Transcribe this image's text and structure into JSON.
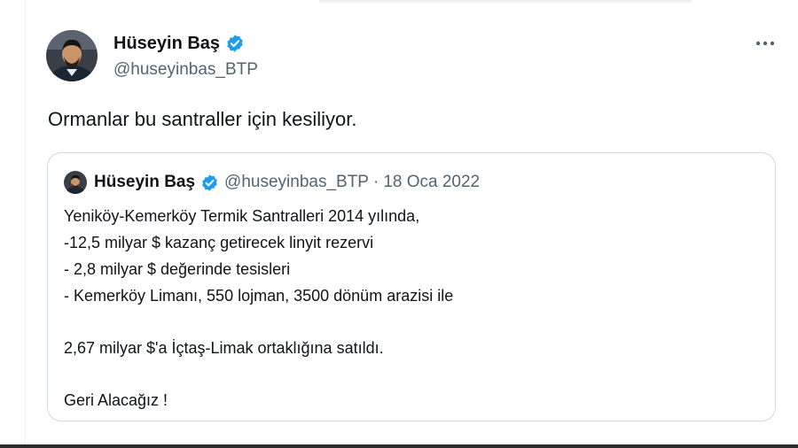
{
  "tweet": {
    "author_name": "Hüseyin Baş",
    "author_handle": "@huseyinbas_BTP",
    "text": "Ormanlar bu santraller için kesiliyor.",
    "more_icon": "more-horizontal-icon"
  },
  "quoted_tweet": {
    "author_name": "Hüseyin Baş",
    "author_handle": "@huseyinbas_BTP",
    "separator": "·",
    "date": "18 Oca 2022",
    "lines": {
      "l1": "Yeniköy-Kemerköy Termik Santralleri 2014 yılında,",
      "l2": "-12,5 milyar $ kazanç getirecek linyit rezervi",
      "l3": "- 2,8 milyar $ değerinde tesisleri",
      "l4": "- Kemerköy Limanı, 550 lojman, 3500 dönüm arazisi ile",
      "l5": "2,67 milyar $'a İçtaş-Limak ortaklığına satıldı.",
      "l6": "Geri Alacağız !"
    }
  },
  "colors": {
    "verified_badge": "#1d9bf0",
    "secondary_text": "#536471",
    "border": "#cfd9de"
  }
}
